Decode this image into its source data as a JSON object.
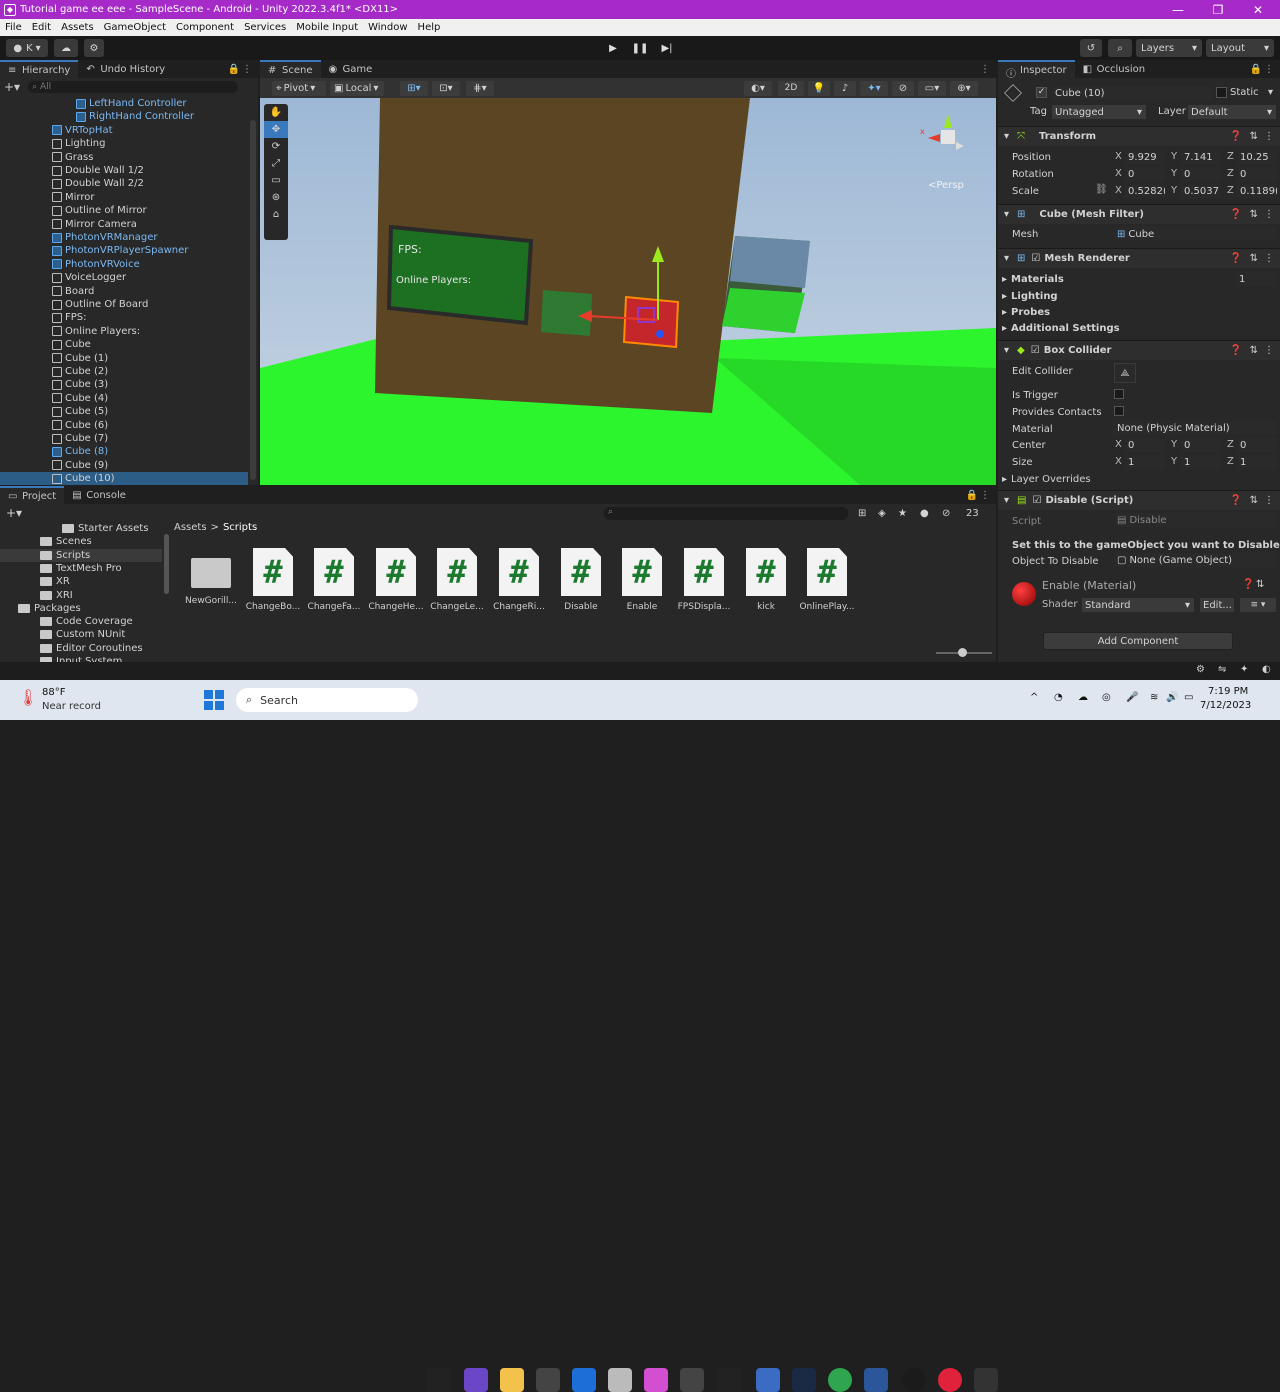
{
  "title_bar": {
    "text": "Tutorial game ee  eee - SampleScene - Android - Unity 2022.3.4f1* <DX11>"
  },
  "menu": [
    "File",
    "Edit",
    "Assets",
    "GameObject",
    "Component",
    "Services",
    "Mobile Input",
    "Window",
    "Help"
  ],
  "toolbar": {
    "account": "K",
    "layers": "Layers",
    "layout": "Layout"
  },
  "hierarchy": {
    "tabs": [
      "Hierarchy",
      "Undo History"
    ],
    "search_placeholder": "All",
    "items": [
      {
        "label": "LeftHand Controller",
        "indent": 76,
        "blue": true
      },
      {
        "label": "RightHand Controller",
        "indent": 76,
        "blue": true
      },
      {
        "label": "VRTopHat",
        "indent": 52,
        "blue": true
      },
      {
        "label": "Lighting",
        "indent": 52,
        "blue": false
      },
      {
        "label": "Grass",
        "indent": 52,
        "blue": false
      },
      {
        "label": "Double Wall 1/2",
        "indent": 52,
        "blue": false
      },
      {
        "label": "Double Wall 2/2",
        "indent": 52,
        "blue": false
      },
      {
        "label": "Mirror",
        "indent": 52,
        "blue": false
      },
      {
        "label": "Outline of Mirror",
        "indent": 52,
        "blue": false
      },
      {
        "label": "Mirror Camera",
        "indent": 52,
        "blue": false
      },
      {
        "label": "PhotonVRManager",
        "indent": 52,
        "blue": true
      },
      {
        "label": "PhotonVRPlayerSpawner",
        "indent": 52,
        "blue": true
      },
      {
        "label": "PhotonVRVoice",
        "indent": 52,
        "blue": true
      },
      {
        "label": "VoiceLogger",
        "indent": 52,
        "blue": false
      },
      {
        "label": "Board",
        "indent": 52,
        "blue": false
      },
      {
        "label": "Outline Of Board",
        "indent": 52,
        "blue": false
      },
      {
        "label": "FPS:",
        "indent": 52,
        "blue": false
      },
      {
        "label": "Online Players:",
        "indent": 52,
        "blue": false
      },
      {
        "label": "Cube",
        "indent": 52,
        "blue": false
      },
      {
        "label": "Cube (1)",
        "indent": 52,
        "blue": false
      },
      {
        "label": "Cube (2)",
        "indent": 52,
        "blue": false
      },
      {
        "label": "Cube (3)",
        "indent": 52,
        "blue": false
      },
      {
        "label": "Cube (4)",
        "indent": 52,
        "blue": false
      },
      {
        "label": "Cube (5)",
        "indent": 52,
        "blue": false
      },
      {
        "label": "Cube (6)",
        "indent": 52,
        "blue": false
      },
      {
        "label": "Cube (7)",
        "indent": 52,
        "blue": false
      },
      {
        "label": "Cube (8)",
        "indent": 52,
        "blue": true
      },
      {
        "label": "Cube (9)",
        "indent": 52,
        "blue": false
      },
      {
        "label": "Cube (10)",
        "indent": 52,
        "blue": false,
        "selected": true
      }
    ]
  },
  "scene": {
    "tabs": [
      "Scene",
      "Game"
    ],
    "pivot": "Pivot",
    "local": "Local",
    "mode_2d": "2D",
    "persp": "<Persp",
    "board_fps": "FPS:",
    "board_players": "Online Players:"
  },
  "project": {
    "tabs": [
      "Project",
      "Console"
    ],
    "tree": [
      {
        "label": "Starter Assets",
        "indent": 62
      },
      {
        "label": "Scenes",
        "indent": 40
      },
      {
        "label": "Scripts",
        "indent": 40,
        "selected": true
      },
      {
        "label": "TextMesh Pro",
        "indent": 40
      },
      {
        "label": "XR",
        "indent": 40
      },
      {
        "label": "XRI",
        "indent": 40
      },
      {
        "label": "Packages",
        "indent": 18
      },
      {
        "label": "Code Coverage",
        "indent": 40
      },
      {
        "label": "Custom NUnit",
        "indent": 40
      },
      {
        "label": "Editor Coroutines",
        "indent": 40
      },
      {
        "label": "Input System",
        "indent": 40
      }
    ],
    "breadcrumb": [
      "Assets",
      "Scripts"
    ],
    "count": "23",
    "assets": [
      "NewGorill...",
      "ChangeBo...",
      "ChangeFa...",
      "ChangeHe...",
      "ChangeLe...",
      "ChangeRi...",
      "Disable",
      "Enable",
      "FPSDispla...",
      "kick",
      "OnlinePlay..."
    ]
  },
  "inspector": {
    "tabs": [
      "Inspector",
      "Occlusion"
    ],
    "object_name": "Cube (10)",
    "static_label": "Static",
    "tag_label": "Tag",
    "tag_value": "Untagged",
    "layer_label": "Layer",
    "layer_value": "Default",
    "transform": {
      "title": "Transform",
      "position_label": "Position",
      "rotation_label": "Rotation",
      "scale_label": "Scale",
      "position": [
        "9.929",
        "7.141",
        "10.25"
      ],
      "rotation": [
        "0",
        "0",
        "0"
      ],
      "scale": [
        "0.5282(",
        "0.5037",
        "0.1189("
      ]
    },
    "mesh_filter": {
      "title": "Cube (Mesh Filter)",
      "mesh_label": "Mesh",
      "mesh_value": "Cube"
    },
    "mesh_renderer": {
      "title": "Mesh Renderer",
      "materials": "Materials",
      "materials_count": "1",
      "lighting": "Lighting",
      "probes": "Probes",
      "additional": "Additional Settings"
    },
    "box_collider": {
      "title": "Box Collider",
      "edit_collider": "Edit Collider",
      "is_trigger": "Is Trigger",
      "provides_contacts": "Provides Contacts",
      "material_label": "Material",
      "material_value": "None (Physic Material)",
      "center_label": "Center",
      "center": [
        "0",
        "0",
        "0"
      ],
      "size_label": "Size",
      "size": [
        "1",
        "1",
        "1"
      ],
      "layer_overrides": "Layer Overrides"
    },
    "disable_script": {
      "title": "Disable (Script)",
      "script_label": "Script",
      "script_value": "Disable",
      "help_text": "Set this to the gameObject you want to Disable",
      "object_label": "Object To Disable",
      "object_value": "None (Game Object)"
    },
    "material": {
      "title": "Enable (Material)",
      "shader_label": "Shader",
      "shader_value": "Standard",
      "edit": "Edit..."
    },
    "add_component": "Add Component"
  },
  "taskbar": {
    "temp": "88°F",
    "weather": "Near record",
    "search": "Search",
    "time": "7:19 PM",
    "date": "7/12/2023"
  },
  "colors": {
    "title": "#a52ac8",
    "accent": "#3a79bb",
    "grass": "#2df52d",
    "wall": "#5c4522"
  }
}
